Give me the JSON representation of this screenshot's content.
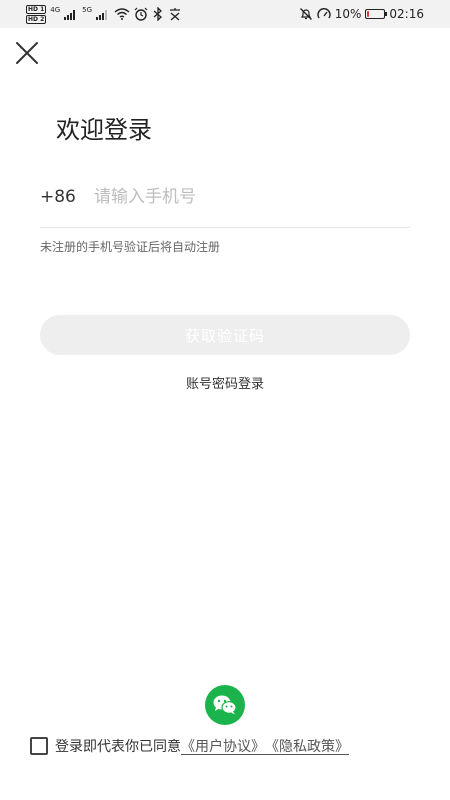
{
  "status_bar": {
    "hd1": "HD 1",
    "hd2": "HD 2",
    "sig1": "4G",
    "sig2": "5G",
    "battery_text": "10%",
    "battery_level": 0.1,
    "time": "02:16",
    "battery_color": "#e53935"
  },
  "title": "欢迎登录",
  "phone": {
    "country_code": "+86",
    "placeholder": "请输入手机号",
    "value": ""
  },
  "hint": "未注册的手机号验证后将自动注册",
  "get_code_label": "获取验证码",
  "password_login_label": "账号密码登录",
  "agreement": {
    "prefix": "登录即代表你已同意",
    "user_agreement": "《用户协议》",
    "privacy_policy": "《隐私政策》"
  },
  "colors": {
    "wechat": "#1bb34b",
    "button_disabled": "#eeeeee"
  },
  "icons": {
    "close": "close-icon",
    "wechat": "wechat-icon"
  }
}
